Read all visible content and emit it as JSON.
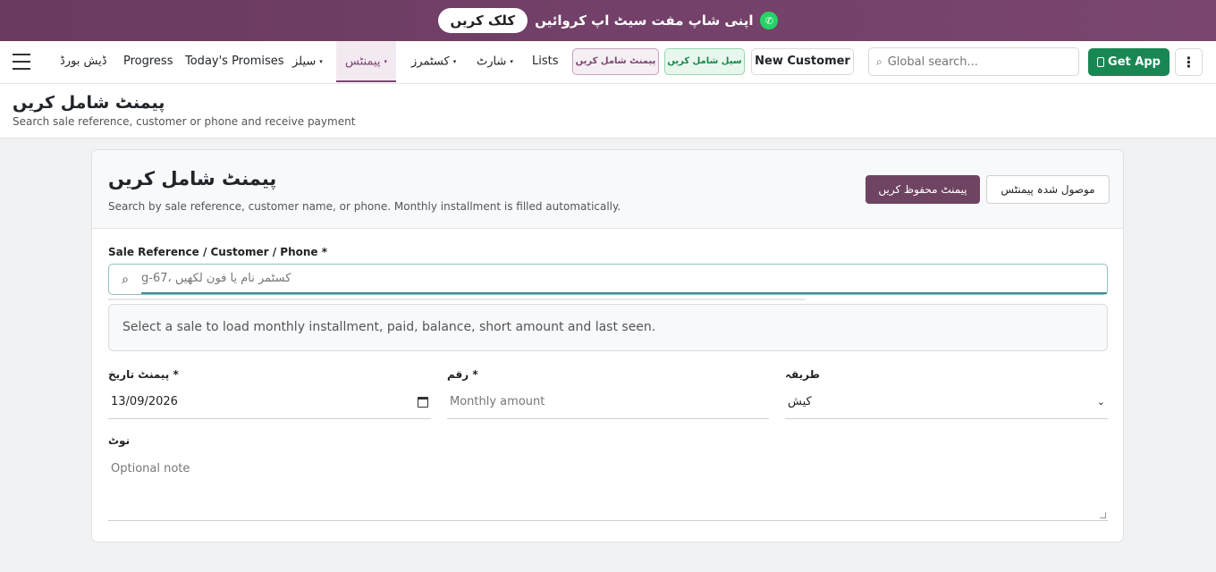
{
  "banner": {
    "button": "کلک کریں",
    "text": "اپنی شاپ مفت سیٹ اپ کروائیں"
  },
  "nav": {
    "items": [
      {
        "label": "ڈیش بورڈ",
        "dropdown": false
      },
      {
        "label": "Progress",
        "dropdown": false
      },
      {
        "label": "Today's Promises",
        "dropdown": false
      },
      {
        "label": "سیلز",
        "dropdown": true
      },
      {
        "label": "پیمنٹس",
        "dropdown": true,
        "active": true
      },
      {
        "label": "کسٹمرز",
        "dropdown": true
      },
      {
        "label": "شارٹ",
        "dropdown": true
      },
      {
        "label": "Lists",
        "dropdown": false
      }
    ],
    "caret": "▾",
    "add_payment": "پیمنٹ شامل کریں",
    "add_sale": "سیل شامل کریں",
    "new_customer": "New Customer",
    "search_placeholder": "Global search...",
    "get_app": "Get App",
    "more": "⋮"
  },
  "page": {
    "title": "پیمنٹ شامل کریں",
    "subtitle": "Search sale reference, customer or phone and receive payment"
  },
  "card": {
    "title": "پیمنٹ شامل کریں",
    "subtitle": "Search by sale reference, customer name, or phone. Monthly installment is filled automatically.",
    "save_button": "پیمنٹ محفوظ کریں",
    "received_button": "موصول شدہ پیمنٹس"
  },
  "form": {
    "ref_label": "Sale Reference / Customer / Phone *",
    "ref_placeholder": "کسٹمر نام یا فون لکھیں ،g-67",
    "info_text": "Select a sale to load monthly installment, paid, balance, short amount and last seen.",
    "date_label": "پیمنٹ تاریخ *",
    "date_value": "13/09/2026",
    "amount_label": "رقم *",
    "amount_placeholder": "Monthly amount",
    "method_label": "طریقہ",
    "method_value": "کیش",
    "note_label": "نوٹ",
    "note_placeholder": "Optional note"
  },
  "colors": {
    "brand": "#7a4670",
    "success": "#198754",
    "save_button": "#6f4362"
  },
  "icons": [
    "whatsapp-icon",
    "menu-icon",
    "search-icon",
    "phone-icon",
    "more-icon",
    "calendar-icon",
    "chevron-down-icon"
  ]
}
